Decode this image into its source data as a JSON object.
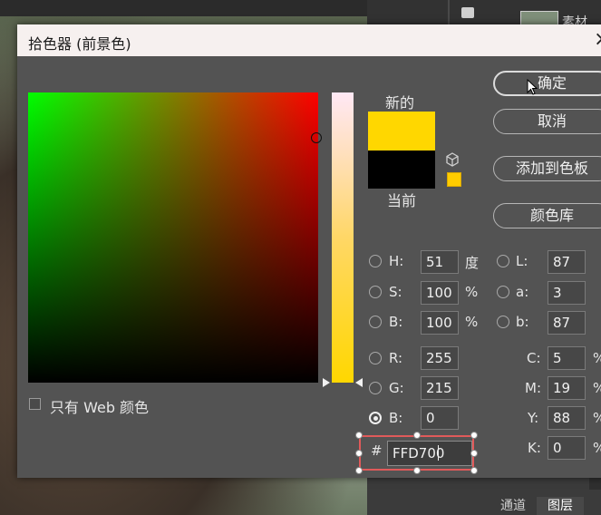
{
  "background": {
    "thumbnail_label": "素材",
    "tabs": [
      "通道",
      "图层"
    ]
  },
  "dialog": {
    "title": "拾色器 (前景色)",
    "close_glyph": "×",
    "web_only_label": "只有 Web 颜色",
    "new_label": "新的",
    "current_label": "当前",
    "new_color": "#FFD700",
    "current_color": "#000000",
    "websafe_color": "#FFCC00",
    "buttons": {
      "ok": "确定",
      "cancel": "取消",
      "add_to_swatches": "添加到色板",
      "color_libraries": "颜色库"
    },
    "hsb": {
      "h_label": "H:",
      "h_value": "51",
      "h_unit": "度",
      "s_label": "S:",
      "s_value": "100",
      "s_unit": "%",
      "b_label": "B:",
      "b_value": "100",
      "b_unit": "%"
    },
    "rgb": {
      "r_label": "R:",
      "r_value": "255",
      "g_label": "G:",
      "g_value": "215",
      "b_label": "B:",
      "b_value": "0",
      "selected": "B"
    },
    "lab": {
      "l_label": "L:",
      "l_value": "87",
      "a_label": "a:",
      "a_value": "3",
      "b_label": "b:",
      "b_value": "87"
    },
    "cmyk": {
      "c_label": "C:",
      "c_value": "5",
      "c_unit": "%",
      "m_label": "M:",
      "m_value": "19",
      "m_unit": "%",
      "y_label": "Y:",
      "y_value": "88",
      "y_unit": "%",
      "k_label": "K:",
      "k_value": "0",
      "k_unit": "%"
    },
    "hex": {
      "hash": "#",
      "value": "FFD700"
    }
  }
}
